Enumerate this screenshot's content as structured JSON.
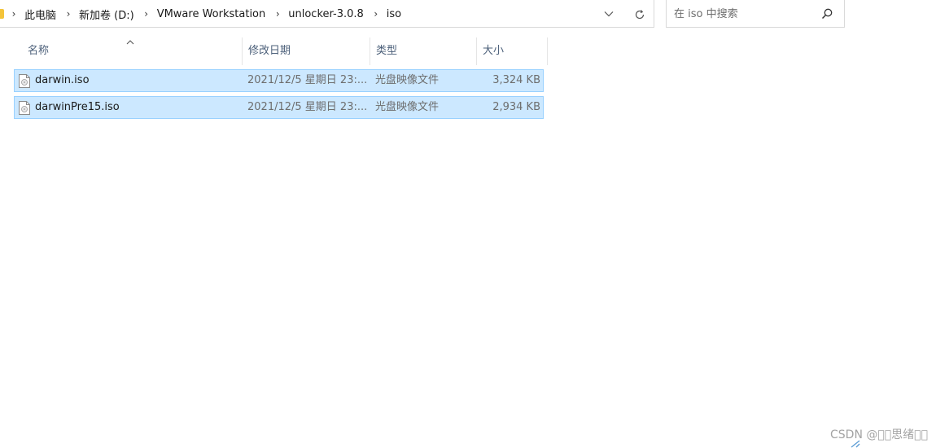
{
  "address_bar": {
    "crumbs": [
      "此电脑",
      "新加卷 (D:)",
      "VMware Workstation",
      "unlocker-3.0.8",
      "iso"
    ],
    "separator_icon": "chevron-right-icon",
    "dropdown_icon": "chevron-down-icon",
    "refresh_icon": "refresh-icon"
  },
  "search": {
    "placeholder": "在 iso 中搜索",
    "icon": "search-icon"
  },
  "columns": {
    "name": "名称",
    "date": "修改日期",
    "type": "类型",
    "size": "大小",
    "sort_icon": "sort-up-icon"
  },
  "files": [
    {
      "name": "darwin.iso",
      "date": "2021/12/5 星期日 23:...",
      "type": "光盘映像文件",
      "size": "3,324 KB",
      "selected": true,
      "icon": "disc-image-file-icon"
    },
    {
      "name": "darwinPre15.iso",
      "date": "2021/12/5 星期日 23:...",
      "type": "光盘映像文件",
      "size": "2,934 KB",
      "selected": true,
      "icon": "disc-image-file-icon"
    }
  ],
  "watermark": "CSDN @\u0000\u0000思绪\u0000\u0000",
  "colors": {
    "selection_bg": "#cce8ff",
    "selection_border": "#99d1ff",
    "header_text": "#4c607a",
    "folder": "#f4c43a"
  }
}
